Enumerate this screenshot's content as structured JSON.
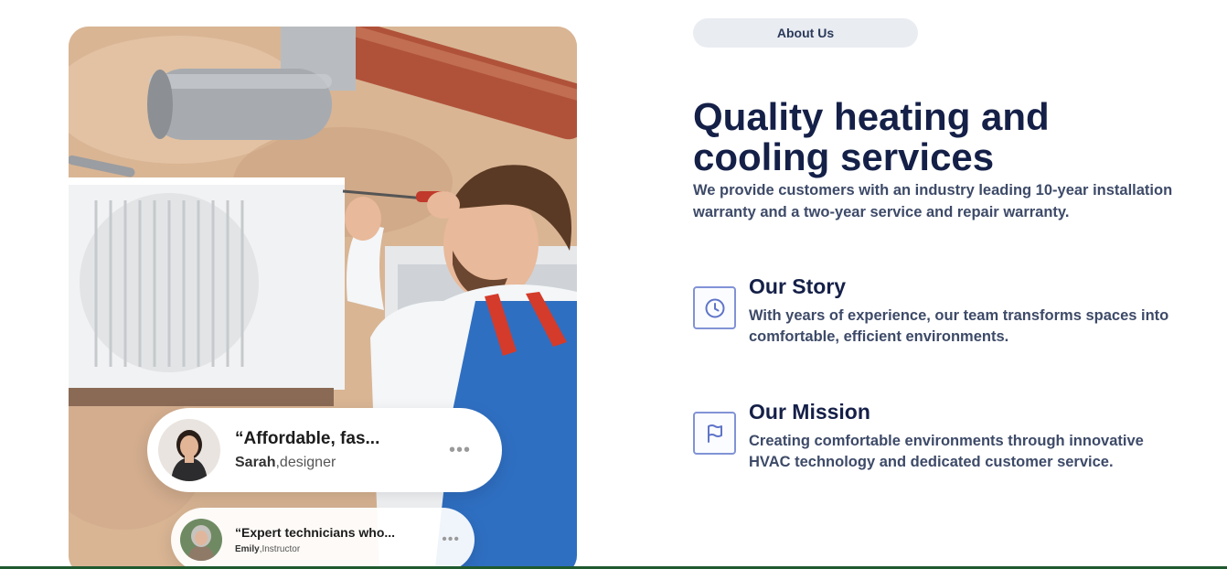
{
  "about": {
    "label": "About Us"
  },
  "hero": {
    "title": "Quality heating and cooling services",
    "description": "We provide customers with an industry leading 10-year installation warranty and a two-year service and repair warranty."
  },
  "features": [
    {
      "icon": "clock-icon",
      "title": "Our Story",
      "description": "With years of experience, our team transforms spaces into comfortable, efficient environments."
    },
    {
      "icon": "flag-icon",
      "title": "Our Mission",
      "description": "Creating comfortable environments through innovative HVAC technology and dedicated customer service."
    }
  ],
  "testimonials": [
    {
      "quote": "“Affordable, fas...",
      "name": "Sarah",
      "role": ",designer",
      "more": "•••"
    },
    {
      "quote": "“Expert technicians who...",
      "name": "Emily",
      "role": ",Instructor",
      "more": "•••"
    }
  ],
  "colors": {
    "navy": "#152048",
    "body_text": "#3d4a68",
    "icon_border": "#8193d6",
    "pill_bg": "#e9ecf1",
    "bottom_bar": "#1f5a2f"
  }
}
